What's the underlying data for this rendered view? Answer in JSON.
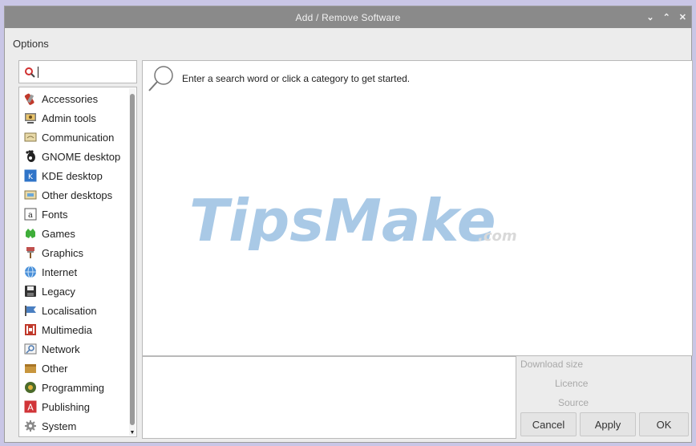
{
  "window": {
    "title": "Add / Remove Software",
    "controls": {
      "minimize": "⌄",
      "maximize": "⌃",
      "close": "✕"
    }
  },
  "menu": {
    "options": "Options"
  },
  "search": {
    "value": "",
    "placeholder": ""
  },
  "categories": [
    {
      "label": "Accessories",
      "icon": "accessories-icon"
    },
    {
      "label": "Admin tools",
      "icon": "admin-tools-icon"
    },
    {
      "label": "Communication",
      "icon": "communication-icon"
    },
    {
      "label": "GNOME desktop",
      "icon": "gnome-icon"
    },
    {
      "label": "KDE desktop",
      "icon": "kde-icon"
    },
    {
      "label": "Other desktops",
      "icon": "other-desktops-icon"
    },
    {
      "label": "Fonts",
      "icon": "fonts-icon"
    },
    {
      "label": "Games",
      "icon": "games-icon"
    },
    {
      "label": "Graphics",
      "icon": "graphics-icon"
    },
    {
      "label": "Internet",
      "icon": "internet-icon"
    },
    {
      "label": "Legacy",
      "icon": "legacy-icon"
    },
    {
      "label": "Localisation",
      "icon": "localisation-icon"
    },
    {
      "label": "Multimedia",
      "icon": "multimedia-icon"
    },
    {
      "label": "Network",
      "icon": "network-icon"
    },
    {
      "label": "Other",
      "icon": "other-icon"
    },
    {
      "label": "Programming",
      "icon": "programming-icon"
    },
    {
      "label": "Publishing",
      "icon": "publishing-icon"
    },
    {
      "label": "System",
      "icon": "system-icon"
    }
  ],
  "results": {
    "prompt": "Enter a search word or click a category to get started."
  },
  "watermark": {
    "brand": "TipsMake",
    "suffix": ".com"
  },
  "details": {
    "download_size": "Download size",
    "licence": "Licence",
    "source": "Source"
  },
  "buttons": {
    "cancel": "Cancel",
    "apply": "Apply",
    "ok": "OK"
  }
}
